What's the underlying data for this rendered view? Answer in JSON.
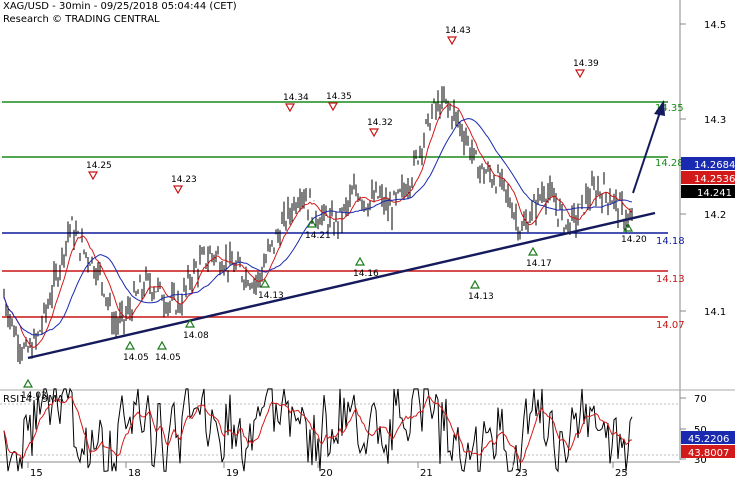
{
  "header": {
    "line1": "XAG/USD - 30min - 09/25/2018 05:04:44 (CET)",
    "line2": "Research © TRADING CENTRAL"
  },
  "rsi": {
    "label": "RSI14 - 9MA",
    "ticks": [
      "70",
      "50",
      "30"
    ],
    "rsi_value": "45.2206",
    "ma_value": "43.8007"
  },
  "price_axis": {
    "ticks": [
      "14.5",
      "14.3",
      "14.2",
      "14.1"
    ],
    "last": "14.2684",
    "prev": "14.2536",
    "current": "14.241"
  },
  "colors": {
    "support_blue": "#0b1a9c",
    "resistance_green": "#1a8a1a",
    "level_red": "#c81414",
    "ma_red": "#d21a1a",
    "ma_blue": "#1a2ab0",
    "trend_navy": "#151a5c",
    "up_marker": "#1a7a1a",
    "down_marker": "#c81414"
  },
  "chart_data": {
    "type": "line",
    "title": "XAG/USD - 30min",
    "x_dates": [
      "15",
      "18",
      "19",
      "20",
      "21",
      "23",
      "25"
    ],
    "horizontal_levels": [
      {
        "label": "14.35",
        "price": 14.32,
        "color": "green"
      },
      {
        "label": "14.28",
        "price": 14.26,
        "color": "green"
      },
      {
        "label": "14.18",
        "price": 14.18,
        "color": "blue"
      },
      {
        "label": "14.13",
        "price": 14.14,
        "color": "red"
      },
      {
        "label": "14.07",
        "price": 14.1,
        "color": "red"
      }
    ],
    "pivot_markers": [
      {
        "label": "14.25",
        "type": "high"
      },
      {
        "label": "14.23",
        "type": "high"
      },
      {
        "label": "14.34",
        "type": "high"
      },
      {
        "label": "14.35",
        "type": "high"
      },
      {
        "label": "14.32",
        "type": "high"
      },
      {
        "label": "14.43",
        "type": "high"
      },
      {
        "label": "14.39",
        "type": "high"
      },
      {
        "label": "14.05",
        "type": "low"
      },
      {
        "label": "14.05",
        "type": "low"
      },
      {
        "label": "14.08",
        "type": "low"
      },
      {
        "label": "14.13",
        "type": "low"
      },
      {
        "label": "14.21",
        "type": "low"
      },
      {
        "label": "14.16",
        "type": "low"
      },
      {
        "label": "14.13",
        "type": "low"
      },
      {
        "label": "14.17",
        "type": "low"
      },
      {
        "label": "14.20",
        "type": "low"
      },
      {
        "label": "14.03",
        "type": "low"
      }
    ],
    "price_path": [
      {
        "x": "15",
        "y": 14.12
      },
      {
        "y": 14.07
      },
      {
        "y": 14.04
      },
      {
        "y": 14.06
      },
      {
        "y": 14.11
      },
      {
        "y": 14.16
      },
      {
        "y": 14.22
      },
      {
        "y": 14.19
      },
      {
        "y": 14.17
      },
      {
        "y": 14.14
      },
      {
        "y": 14.08
      },
      {
        "y": 14.09
      },
      {
        "y": 14.12
      },
      {
        "y": 14.14
      },
      {
        "y": 14.13
      },
      {
        "y": 14.11
      },
      {
        "y": 14.11
      },
      {
        "y": 14.15
      },
      {
        "y": 14.17
      },
      {
        "y": 14.18
      },
      {
        "y": 14.17
      },
      {
        "y": 14.16
      },
      {
        "y": 14.15
      },
      {
        "y": 14.14
      },
      {
        "y": 14.18
      },
      {
        "y": 14.21
      },
      {
        "y": 14.24
      },
      {
        "y": 14.27
      },
      {
        "y": 14.24
      },
      {
        "y": 14.23
      },
      {
        "y": 14.22
      },
      {
        "y": 14.24
      },
      {
        "y": 14.27
      },
      {
        "y": 14.25
      },
      {
        "y": 14.26
      },
      {
        "y": 14.24
      },
      {
        "y": 14.26
      },
      {
        "y": 14.29
      },
      {
        "y": 14.34
      },
      {
        "y": 14.38
      },
      {
        "y": 14.39
      },
      {
        "y": 14.37
      },
      {
        "y": 14.34
      },
      {
        "y": 14.3
      },
      {
        "y": 14.29
      },
      {
        "y": 14.28
      },
      {
        "y": 14.25
      },
      {
        "y": 14.21
      },
      {
        "y": 14.24
      },
      {
        "y": 14.27
      },
      {
        "y": 14.25
      },
      {
        "y": 14.22
      },
      {
        "y": 14.23
      },
      {
        "y": 14.26
      },
      {
        "y": 14.27
      },
      {
        "y": 14.26
      },
      {
        "y": 14.24
      },
      {
        "y": 14.22
      }
    ],
    "rsi_range": [
      20,
      80
    ],
    "rsi_ticks": [
      30,
      50,
      70
    ],
    "ylim": [
      14.0,
      14.55
    ],
    "grid": true
  }
}
